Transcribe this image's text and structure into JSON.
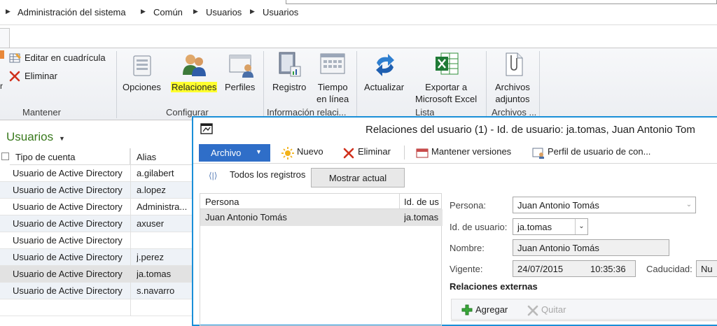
{
  "breadcrumb": [
    "Administración del sistema",
    "Común",
    "Usuarios",
    "Usuarios"
  ],
  "ribbon": {
    "mantener": {
      "edit_grid": "Editar en cuadrícula",
      "delete": "Eliminar",
      "label": "Mantener"
    },
    "configurar": {
      "opciones": "Opciones",
      "relaciones": "Relaciones",
      "perfiles": "Perfiles",
      "label": "Configurar"
    },
    "informacion": {
      "registro": "Registro",
      "tiempo1": "Tiempo",
      "tiempo2": "en línea",
      "label": "Información relaci..."
    },
    "lista": {
      "actualizar": "Actualizar",
      "exportar1": "Exportar a",
      "exportar2": "Microsoft Excel",
      "label": "Lista"
    },
    "archivos": {
      "adjuntos1": "Archivos",
      "adjuntos2": "adjuntos",
      "label": "Archivos ..."
    }
  },
  "users_list": {
    "title": "Usuarios",
    "columns": [
      "Tipo de cuenta",
      "Alias"
    ],
    "rows": [
      [
        "Usuario de Active Directory",
        "a.gilabert"
      ],
      [
        "Usuario de Active Directory",
        "a.lopez"
      ],
      [
        "Usuario de Active Directory",
        "Administra..."
      ],
      [
        "Usuario de Active Directory",
        "axuser"
      ],
      [
        "Usuario de Active Directory",
        ""
      ],
      [
        "Usuario de Active Directory",
        "j.perez"
      ],
      [
        "Usuario de Active Directory",
        "ja.tomas"
      ],
      [
        "Usuario de Active Directory",
        "s.navarro"
      ]
    ]
  },
  "dialog": {
    "title": "Relaciones del usuario (1) - Id. de usuario: ja.tomas, Juan Antonio Tom",
    "toolbar": {
      "archivo": "Archivo",
      "nuevo": "Nuevo",
      "eliminar": "Eliminar",
      "mantener_versiones": "Mantener versiones",
      "perfil": "Perfil de usuario de con..."
    },
    "filter": {
      "todos": "Todos los registros",
      "mostrar": "Mostrar actual"
    },
    "grid": {
      "columns": [
        "Persona",
        "Id. de us"
      ],
      "row": [
        "Juan Antonio Tomás",
        "ja.tomas"
      ]
    },
    "form": {
      "persona_label": "Persona:",
      "persona_value": "Juan Antonio Tomás",
      "id_label": "Id. de usuario:",
      "id_value": "ja.tomas",
      "nombre_label": "Nombre:",
      "nombre_value": "Juan Antonio Tomás",
      "vigente_label": "Vigente:",
      "vigente_date": "24/07/2015",
      "vigente_time": "10:35:36",
      "caducidad_label": "Caducidad:",
      "caducidad_value": "Nu"
    },
    "relaciones_externas": "Relaciones externas",
    "agregar": "Agregar",
    "quitar": "Quitar"
  }
}
